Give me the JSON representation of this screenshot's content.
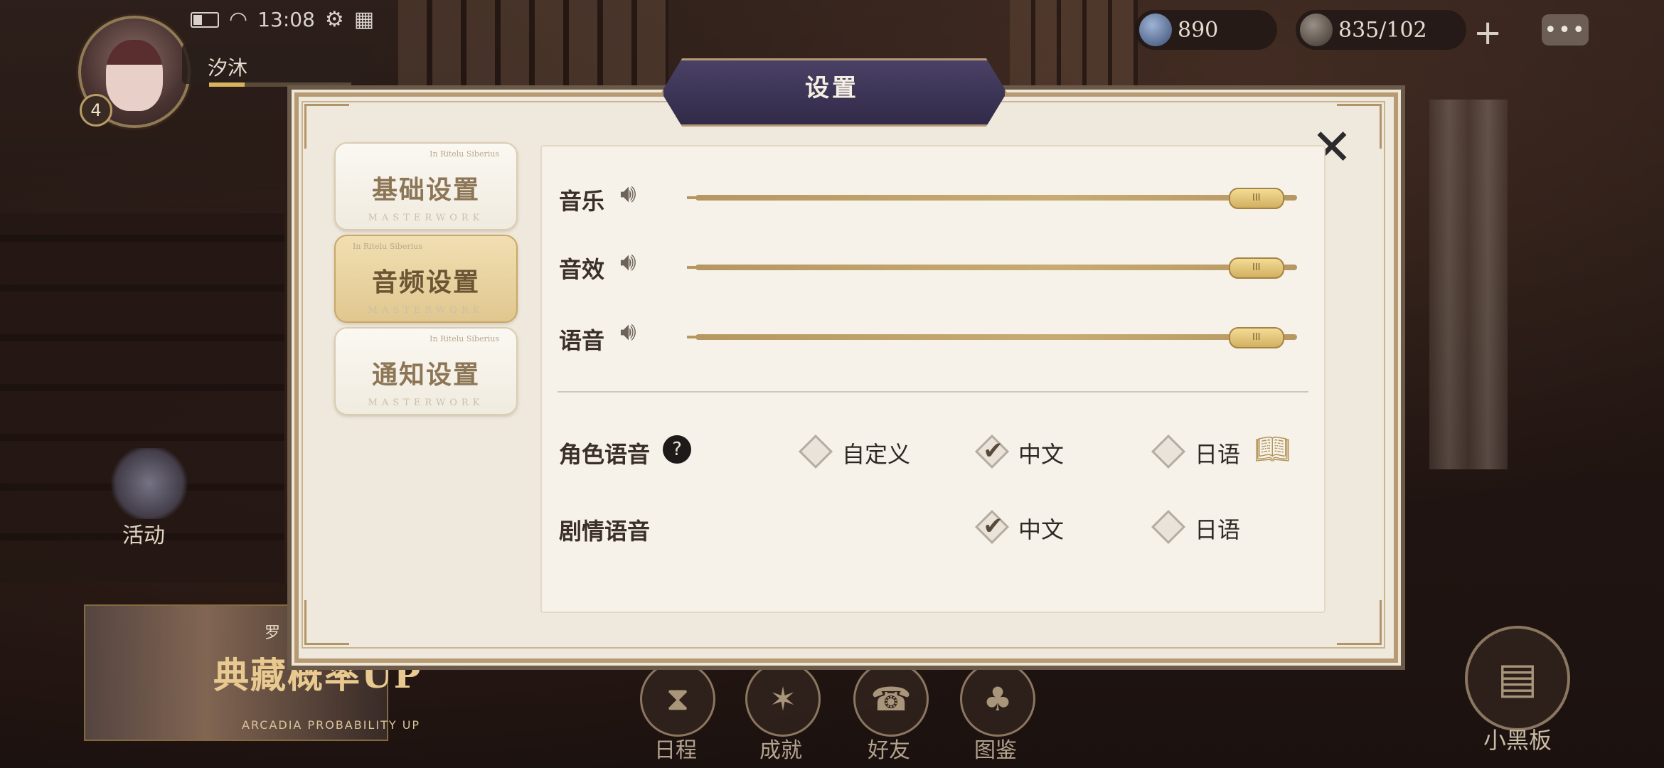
{
  "status": {
    "time": "13:08"
  },
  "player": {
    "name": "汐沐",
    "level": "4"
  },
  "resources": {
    "gems": "890",
    "stamina": "835/102",
    "plus": "+",
    "more": "•••"
  },
  "left": {
    "activity_label": "活动",
    "banner_text": "典藏概率UP",
    "banner_sub": "ARCADIA PROBABILITY UP",
    "banner_tag": "罗"
  },
  "dialog": {
    "title": "设置",
    "tabs": [
      {
        "label": "基础设置",
        "top": "In Ritelu Siberius",
        "sub": "MASTERWORK"
      },
      {
        "label": "音频设置",
        "top": "In Ritelu Siberius",
        "sub": "MASTERWORK",
        "active": true
      },
      {
        "label": "通知设置",
        "top": "In Ritelu Siberius",
        "sub": "MASTERWORK"
      }
    ],
    "volume": [
      {
        "label": "音乐",
        "value": 0.93
      },
      {
        "label": "音效",
        "value": 0.93
      },
      {
        "label": "语音",
        "value": 0.93
      }
    ],
    "handle_text": "III",
    "character_voice": {
      "label": "角色语音",
      "options": [
        "自定义",
        "中文",
        "日语"
      ],
      "selected": "中文"
    },
    "story_voice": {
      "label": "剧情语音",
      "options": [
        "中文",
        "日语"
      ],
      "selected": "中文"
    }
  },
  "bottom_menu": [
    {
      "label": "日程",
      "icon": "hourglass-icon"
    },
    {
      "label": "成就",
      "icon": "star-icon"
    },
    {
      "label": "好友",
      "icon": "phone-icon"
    },
    {
      "label": "图鉴",
      "icon": "tree-icon"
    }
  ],
  "blackboard_label": "小黑板",
  "colors": {
    "accent_gold": "#c8ab72",
    "title_purple": "#3d3658",
    "panel": "#f6f2ea"
  }
}
